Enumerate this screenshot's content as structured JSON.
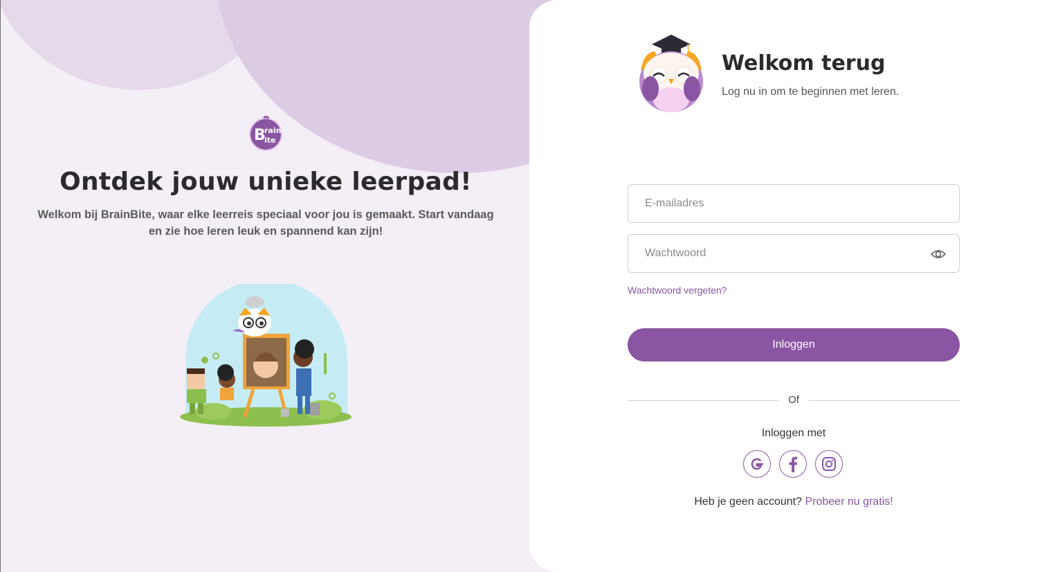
{
  "left": {
    "logo_alt": "BrainBite",
    "headline": "Ontdek jouw unieke leerpad!",
    "subtext": "Welkom bij BrainBite, waar elke leerreis speciaal voor jou is gemaakt. Start vandaag en zie hoe leren leuk en spannend kan zijn!"
  },
  "right": {
    "title": "Welkom terug",
    "subtitle": "Log nu in om te beginnen met leren.",
    "email": {
      "placeholder": "E-mailadres",
      "value": ""
    },
    "password": {
      "placeholder": "Wachtwoord",
      "value": ""
    },
    "forgot_label": "Wachtwoord vergeten?",
    "login_label": "Inloggen",
    "divider_label": "Of",
    "login_with_label": "Inloggen met",
    "socials": [
      {
        "name": "google-icon",
        "label": "G"
      },
      {
        "name": "facebook-icon",
        "label": "f"
      },
      {
        "name": "instagram-icon",
        "label": ""
      }
    ],
    "signup_prompt": "Heb je geen account?",
    "signup_link": "Probeer nu gratis!"
  },
  "colors": {
    "brand_purple": "#8a55a2",
    "link_purple": "#8754a0",
    "left_bg": "#f4eff6",
    "blob_light": "#e6d9ea",
    "blob_dark": "#dccce3"
  }
}
